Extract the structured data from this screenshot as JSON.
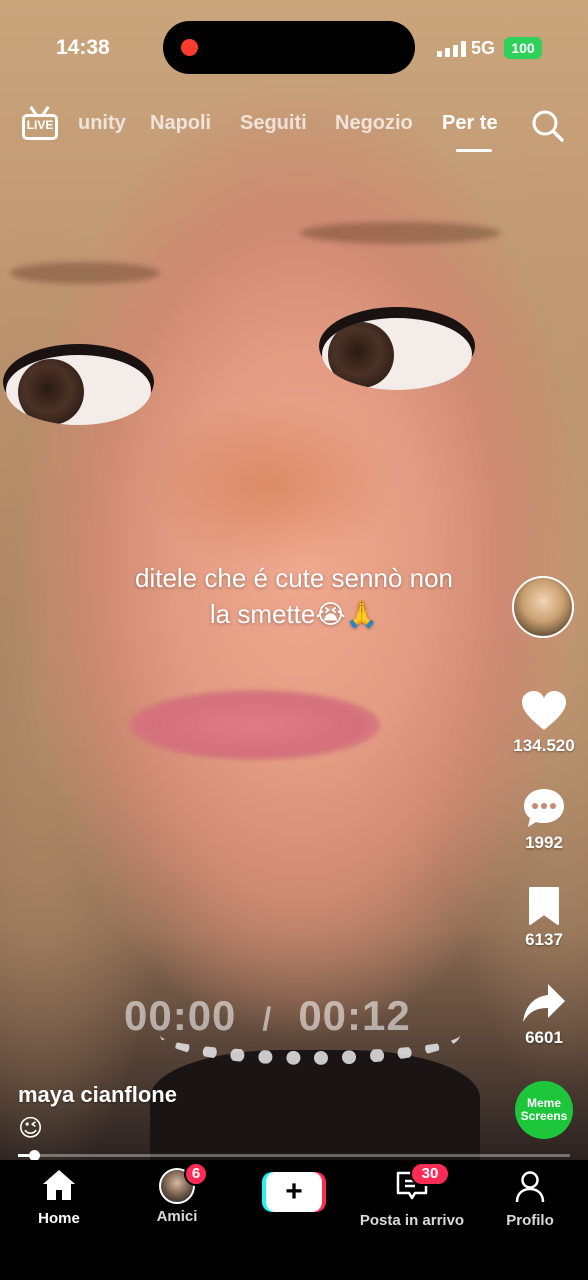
{
  "status_bar": {
    "time": "14:38",
    "network": "5G",
    "battery": "100"
  },
  "top_nav": {
    "live_label": "LIVE",
    "tabs": [
      {
        "label": "unity"
      },
      {
        "label": "Napoli"
      },
      {
        "label": "Seguiti"
      },
      {
        "label": "Negozio"
      },
      {
        "label": "Per te"
      }
    ],
    "active_tab": "Per te"
  },
  "video": {
    "caption_line1": "ditele che é cute sennò non",
    "caption_line2": "la smette😭🙏",
    "elapsed": "00:00",
    "separator": "/",
    "duration": "00:12",
    "progress": 0.02
  },
  "author": {
    "name": "maya cianflone",
    "description": "😉"
  },
  "actions": {
    "likes": "134.520",
    "comments": "1992",
    "saves": "6137",
    "shares": "6601"
  },
  "sound": {
    "label": "Meme Screens"
  },
  "bottom_nav": {
    "home": "Home",
    "friends": "Amici",
    "friends_badge": "6",
    "create": "+",
    "inbox": "Posta in arrivo",
    "inbox_badge": "30",
    "profile": "Profilo"
  },
  "colors": {
    "accent": "#fe2c55",
    "cyan": "#25f4ee",
    "battery": "#30d158",
    "sound_disc": "#1ec63c"
  }
}
